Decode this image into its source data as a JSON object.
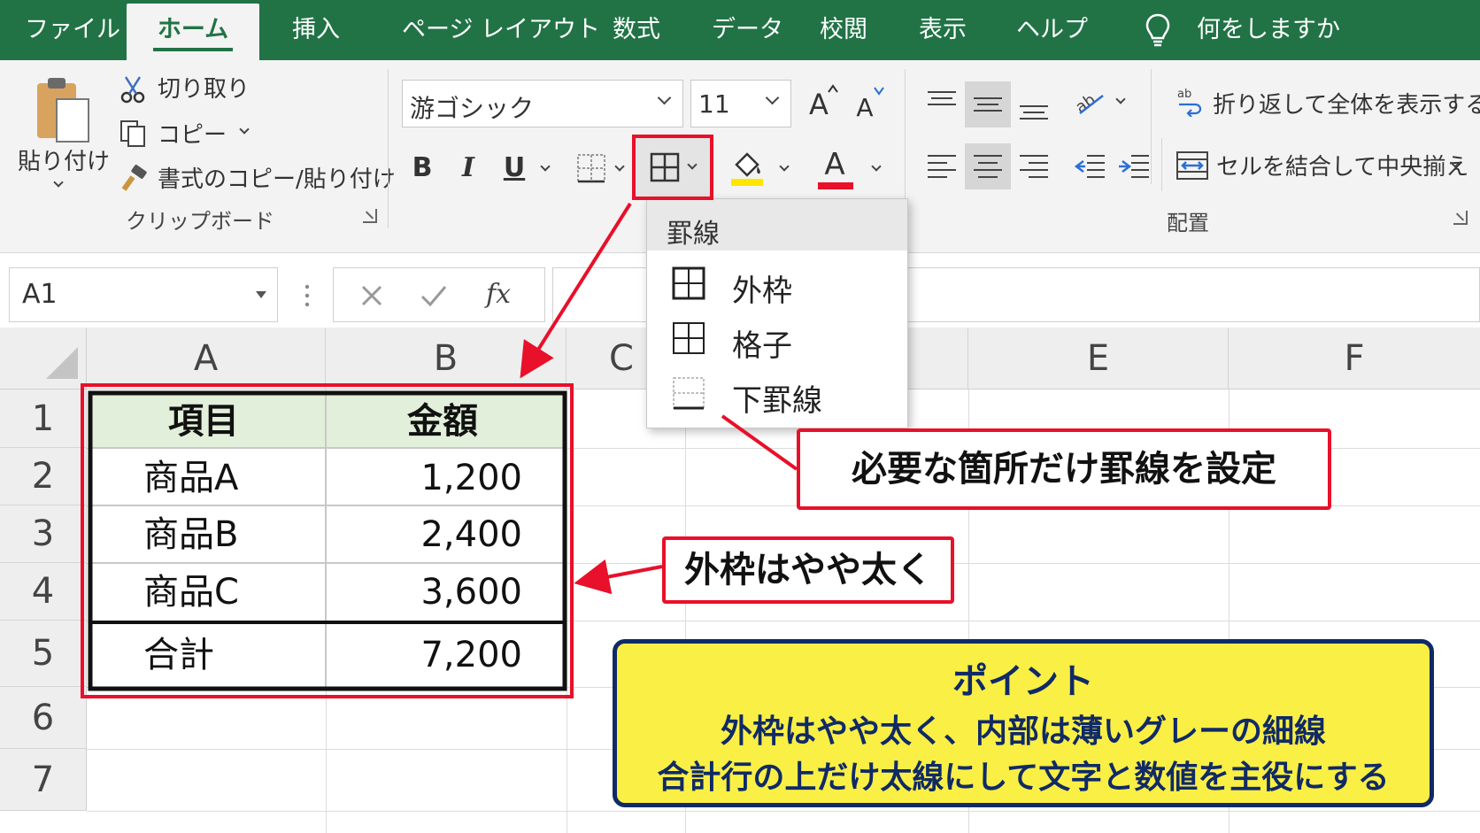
{
  "tabs": [
    {
      "label": "ファイル"
    },
    {
      "label": "ホーム"
    },
    {
      "label": "挿入"
    },
    {
      "label": "ページ レイアウト"
    },
    {
      "label": "数式"
    },
    {
      "label": "データ"
    },
    {
      "label": "校閲"
    },
    {
      "label": "表示"
    },
    {
      "label": "ヘルプ"
    }
  ],
  "active_tab": "ホーム",
  "tell_me": "何をしますか",
  "clipboard": {
    "paste": "貼り付け",
    "cut": "切り取り",
    "copy": "コピー",
    "format_painter": "書式のコピー/貼り付け",
    "group_label": "クリップボード"
  },
  "font": {
    "name": "游ゴシック",
    "size": "11",
    "bold": "B",
    "italic": "I",
    "underline": "U",
    "font_color_glyph": "A",
    "grow_glyph": "A",
    "shrink_glyph": "A"
  },
  "alignment": {
    "wrap_text": "折り返して全体を表示する",
    "merge_center": "セルを結合して中央揃え",
    "group_label": "配置"
  },
  "formula_bar": {
    "name_box": "A1",
    "fx": "fx"
  },
  "columns": [
    "A",
    "B",
    "C",
    "E",
    "F"
  ],
  "rows": [
    "1",
    "2",
    "3",
    "4",
    "5",
    "6",
    "7"
  ],
  "table": {
    "header": {
      "item": "項目",
      "amount": "金額"
    },
    "rows": [
      {
        "item": "商品A",
        "amount": "1,200"
      },
      {
        "item": "商品B",
        "amount": "2,400"
      },
      {
        "item": "商品C",
        "amount": "3,600"
      }
    ],
    "total": {
      "item": "合計",
      "amount": "7,200"
    }
  },
  "borders_menu": {
    "title": "罫線",
    "items": [
      {
        "label": "外枠"
      },
      {
        "label": "格子"
      },
      {
        "label": "下罫線"
      }
    ]
  },
  "callouts": {
    "set_borders": "必要な箇所だけ罫線を設定",
    "outer_thick": "外枠はやや太く"
  },
  "point": {
    "title": "ポイント",
    "line1": "外枠はやや太く、内部は薄いグレーの細線",
    "line2": "合計行の上だけ太線にして文字と数値を主役にする"
  },
  "colors": {
    "excel_green": "#217346",
    "header_fill": "#e2efda",
    "highlight_red": "#e8102a",
    "point_yellow": "#faef45",
    "point_navy": "#102a66",
    "fill_color_bar": "#ffe600",
    "font_color_bar": "#e8102a"
  }
}
